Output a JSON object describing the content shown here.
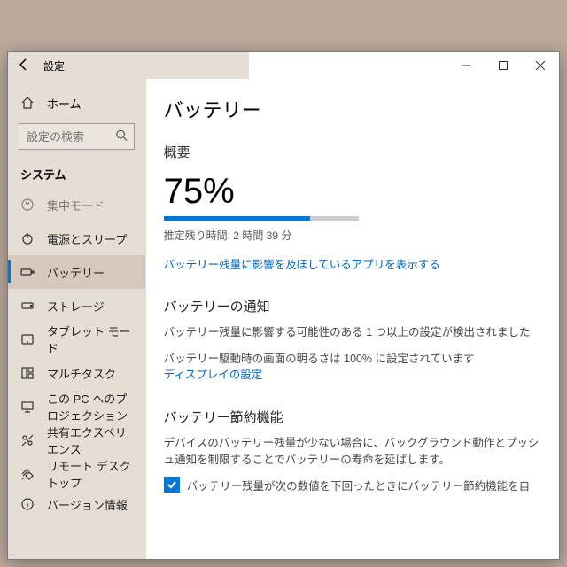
{
  "window": {
    "app_title": "設定"
  },
  "sidebar": {
    "home_label": "ホーム",
    "search_placeholder": "設定の検索",
    "category_label": "システム",
    "items": [
      {
        "label": "集中モード"
      },
      {
        "label": "電源とスリープ"
      },
      {
        "label": "バッテリー"
      },
      {
        "label": "ストレージ"
      },
      {
        "label": "タブレット モード"
      },
      {
        "label": "マルチタスク"
      },
      {
        "label": "この PC へのプロジェクション"
      },
      {
        "label": "共有エクスペリエンス"
      },
      {
        "label": "リモート デスクトップ"
      },
      {
        "label": "バージョン情報"
      }
    ]
  },
  "main": {
    "page_title": "バッテリー",
    "overview_label": "概要",
    "percent_text": "75%",
    "percent_value": 75,
    "estimated_label": "推定残り時間: 2 時間 39 分",
    "apps_link": "バッテリー残量に影響を及ぼしているアプリを表示する",
    "notice": {
      "heading": "バッテリーの通知",
      "line1": "バッテリー残量に影響する可能性のある 1 つ以上の設定が検出されました",
      "line2": "バッテリー駆動時の画面の明るさは 100% に設定されています",
      "display_link": "ディスプレイの設定"
    },
    "saver": {
      "heading": "バッテリー節約機能",
      "desc": "デバイスのバッテリー残量が少ない場合に、バックグラウンド動作とプッシュ通知を制限することでバッテリーの寿命を延ばします。",
      "checkbox_label": "バッテリー残量が次の数値を下回ったときにバッテリー節約機能を自"
    }
  }
}
